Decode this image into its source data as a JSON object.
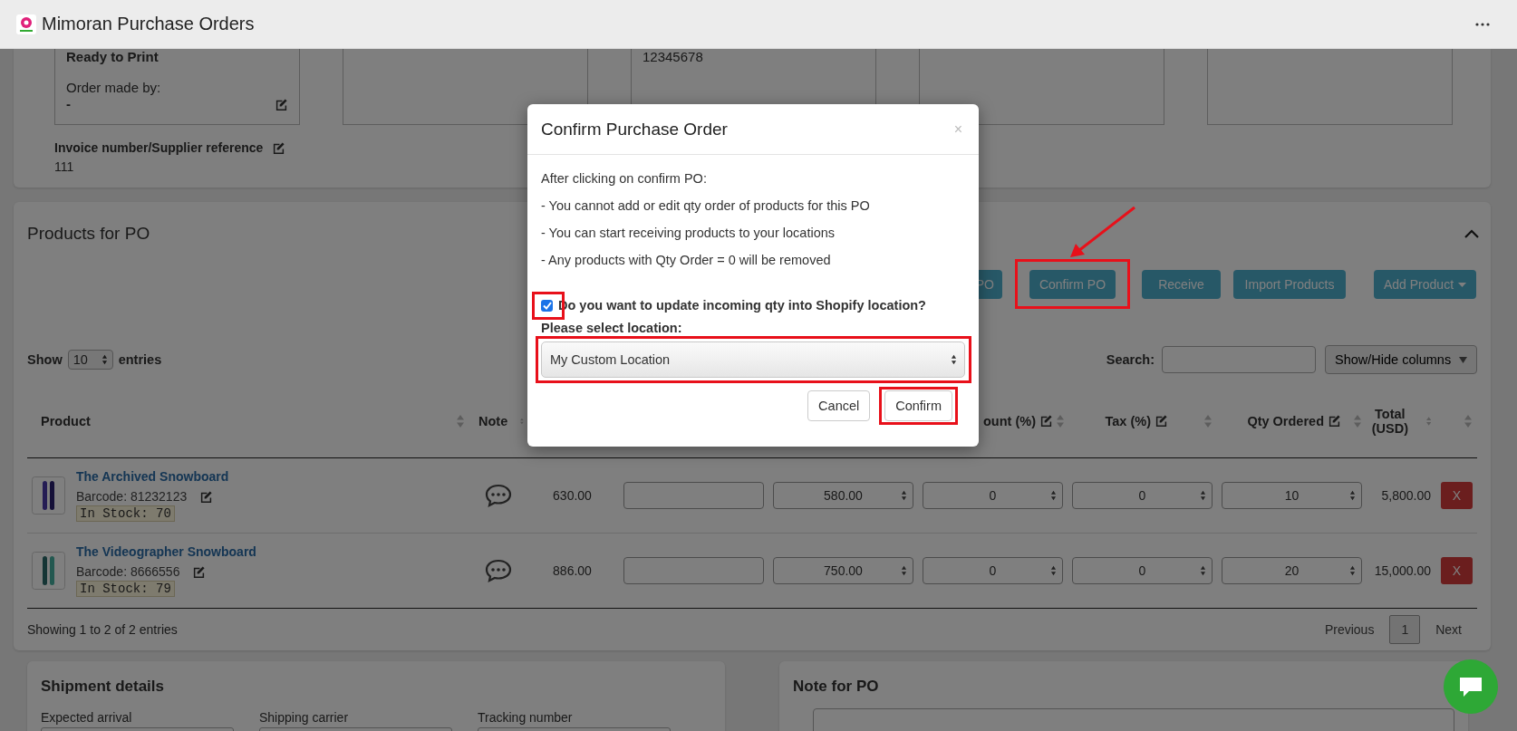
{
  "app": {
    "title": "Mimoran Purchase Orders"
  },
  "summary": {
    "status": "Ready to Print",
    "made_by_label": "Order made by:",
    "made_by": "-",
    "reference": "12345678",
    "invoice_label": "Invoice number/Supplier reference",
    "invoice": "111"
  },
  "products": {
    "title": "Products for PO",
    "expanded": true,
    "actions": [
      {
        "label": "PO",
        "highlighted": false,
        "pointed": false,
        "dropdown": false
      },
      {
        "label": "Confirm PO",
        "highlighted": true,
        "pointed": true,
        "dropdown": false
      },
      {
        "label": "Receive",
        "highlighted": false,
        "pointed": false,
        "dropdown": false
      },
      {
        "label": "Import Products",
        "highlighted": false,
        "pointed": false,
        "dropdown": false
      },
      {
        "label": "Add Product",
        "highlighted": false,
        "pointed": false,
        "dropdown": true
      }
    ],
    "show_label": "Show",
    "page_size": "10",
    "entries_label": "entries",
    "search_label": "Search:",
    "columns_button": "Show/Hide columns",
    "columns": [
      {
        "label": "Product",
        "editable": false,
        "sortable": true
      },
      {
        "label": "Note",
        "editable": false,
        "sortable": true
      },
      {},
      {},
      {},
      {
        "label": "ount (%)",
        "editable": true,
        "sortable": true
      },
      {
        "label": "Tax (%)",
        "editable": true,
        "sortable": true
      },
      {
        "label": "Qty Ordered",
        "editable": true,
        "sortable": true
      },
      {
        "label": "Total (USD)",
        "editable": false,
        "sortable": true
      },
      {
        "sortable": true
      }
    ],
    "rows": [
      {
        "name": "The Archived Snowboard",
        "barcode": "Barcode: 81232123",
        "stock": "In Stock: 70",
        "column_3": "630.00",
        "column_5": "580.00",
        "discount": "0",
        "tax": "0",
        "qty": "10",
        "total": "5,800.00",
        "remove": "X"
      },
      {
        "name": "The Videographer Snowboard",
        "barcode": "Barcode: 8666556",
        "stock": "In Stock: 79",
        "column_3": "886.00",
        "column_5": "750.00",
        "discount": "0",
        "tax": "0",
        "qty": "20",
        "total": "15,000.00",
        "remove": "X"
      }
    ],
    "info": "Showing 1 to 2 of 2 entries",
    "pagination": {
      "previous": "Previous",
      "pages": [
        {
          "label": "1",
          "selected": true
        }
      ],
      "next": "Next"
    }
  },
  "shipment": {
    "title": "Shipment details",
    "fields": [
      {
        "label": "Expected arrival"
      },
      {
        "label": "Shipping carrier"
      },
      {
        "label": "Tracking number"
      }
    ]
  },
  "note": {
    "title": "Note for PO"
  },
  "modal": {
    "title": "Confirm Purchase Order",
    "close": "×",
    "intro": "After clicking on confirm PO:",
    "points": [
      "- You cannot add or edit qty order of products for this PO",
      "- You can start receiving products to your locations",
      "- Any products with Qty Order = 0 will be removed"
    ],
    "update": {
      "label": "Do you want to update incoming qty into Shopify location?",
      "checked": true,
      "highlighted": true
    },
    "location": {
      "label": "Please select location:",
      "value": "My Custom Location",
      "highlighted": true
    },
    "buttons": [
      {
        "label": "Cancel",
        "highlighted": false
      },
      {
        "label": "Confirm",
        "highlighted": true
      }
    ]
  }
}
